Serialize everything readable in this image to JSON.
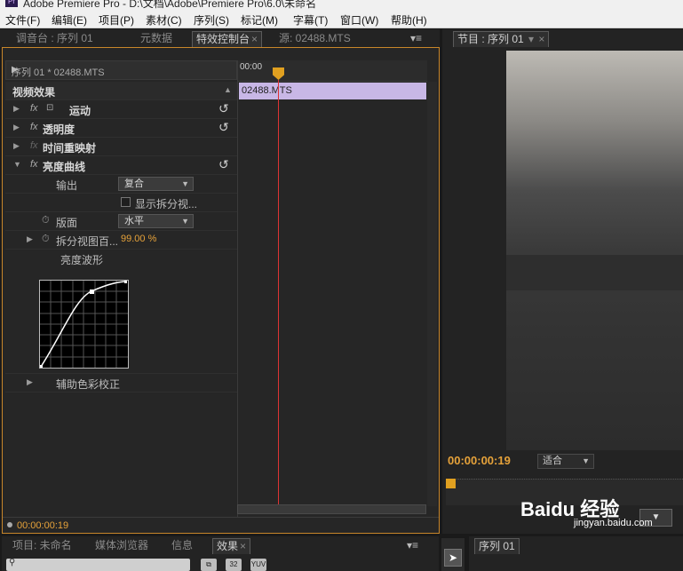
{
  "window": {
    "title": "Adobe Premiere Pro - D:\\文档\\Adobe\\Premiere Pro\\6.0\\未命名"
  },
  "menu": [
    "文件(F)",
    "编辑(E)",
    "项目(P)",
    "素材(C)",
    "序列(S)",
    "标记(M)",
    "字幕(T)",
    "窗口(W)",
    "帮助(H)"
  ],
  "left_tabs": {
    "mixer": "调音台 : 序列 01",
    "metadata": "元数据",
    "effect_controls": "特效控制台",
    "source": "源: 02488.MTS"
  },
  "program_tab": "节目 : 序列 01",
  "effect_controls": {
    "header": "序列 01 * 02488.MTS",
    "section": "视频效果",
    "effects": {
      "motion": "运动",
      "opacity": "透明度",
      "time_remap": "时间重映射",
      "luma_curve": "亮度曲线"
    },
    "params": {
      "output_label": "输出",
      "output_value": "复合",
      "show_split_label": "显示拆分视...",
      "layout_label": "版面",
      "layout_value": "水平",
      "split_percent_label": "拆分视图百...",
      "split_percent_value": "99.00 %",
      "waveform_label": "亮度波形",
      "secondary_label": "辅助色彩校正"
    },
    "timeline": {
      "ruler_label": "00:00",
      "clip_name": "02488.MTS"
    },
    "current_timecode": "00:00:00:19"
  },
  "program": {
    "timecode": "00:00:00:19",
    "fit_label": "适合"
  },
  "bottom_tabs": {
    "project": "项目: 未命名",
    "media_browser": "媒体浏览器",
    "info": "信息",
    "effects": "效果"
  },
  "bottom_right_tab": "序列 01",
  "bin_icons": [
    "32",
    "YUV"
  ],
  "watermark": {
    "brand": "Baidu 经验",
    "url": "jingyan.baidu.com"
  },
  "colors": {
    "accent_orange": "#e6a23a",
    "clip_purple": "#c8b7e6",
    "playhead_red": "#d33333",
    "panel_border_active": "#c8862a"
  }
}
